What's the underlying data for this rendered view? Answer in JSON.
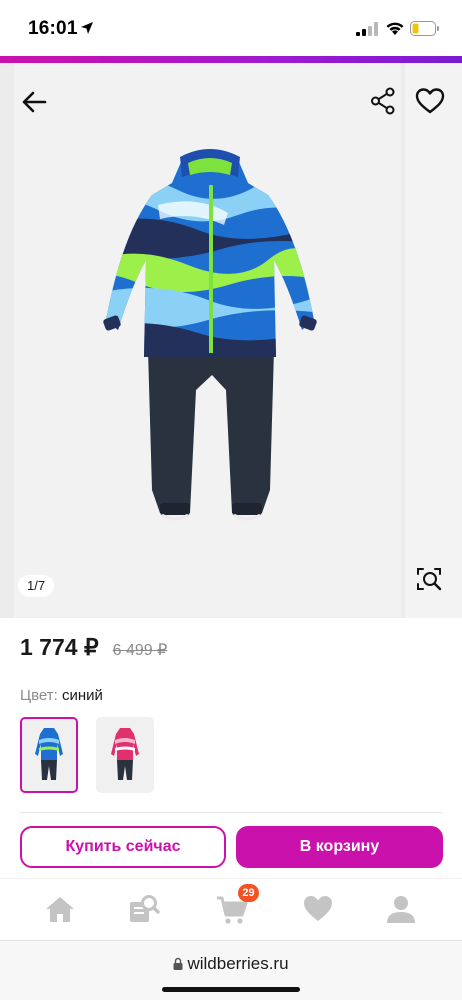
{
  "status_bar": {
    "time": "16:01"
  },
  "gallery": {
    "counter": "1/7",
    "icons": {
      "back": "arrow-left-icon",
      "share": "share-icon",
      "favorite": "heart-icon",
      "image_search": "image-search-icon"
    }
  },
  "product": {
    "price_current": "1 774 ₽",
    "price_old": "6 499 ₽",
    "color_label": "Цвет:",
    "color_value": "синий",
    "swatches": [
      "blue",
      "pink"
    ]
  },
  "actions": {
    "buy_now": "Купить сейчас",
    "add_to_cart": "В корзину"
  },
  "bottom_nav": {
    "items": [
      "home-icon",
      "catalog-search-icon",
      "cart-icon",
      "favorites-heart-icon",
      "profile-icon"
    ],
    "cart_count": "29"
  },
  "browser": {
    "url": "wildberries.ru"
  },
  "colors": {
    "accent": "#cb11ab",
    "badge": "#f55123"
  }
}
